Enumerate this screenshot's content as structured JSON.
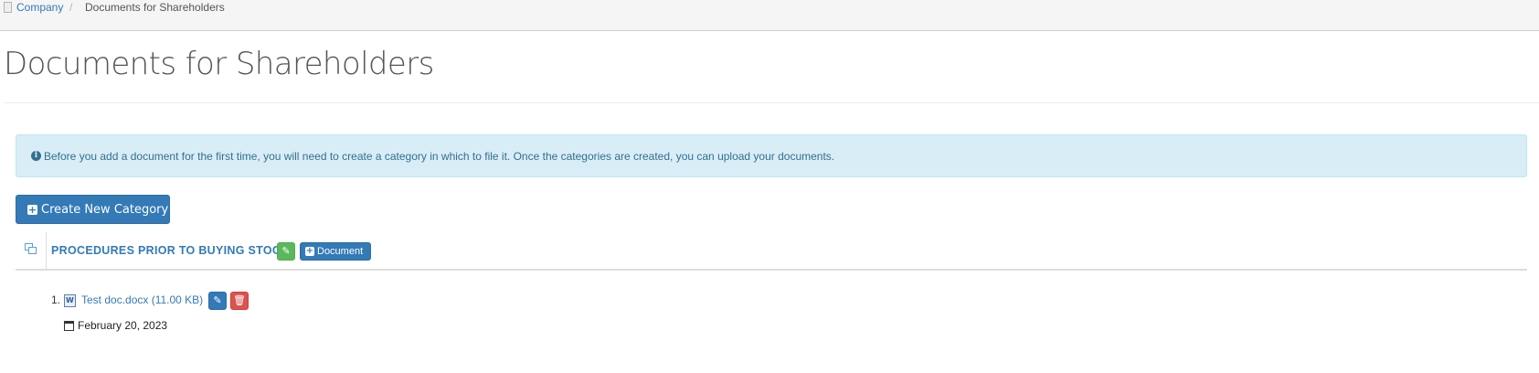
{
  "breadcrumb": {
    "icon": "page-icon",
    "items": [
      {
        "label": "Company"
      },
      {
        "label": "Documents for Shareholders"
      }
    ],
    "separator": "/"
  },
  "page": {
    "title": "Documents for Shareholders"
  },
  "alert": {
    "icon": "info-circle-icon",
    "text": "Before you add a document for the first time, you will need to create a category in which to file it. Once the categories are created, you can upload your documents."
  },
  "actions": {
    "create_category_label": "Create New Category"
  },
  "categories": [
    {
      "name": "PROCEDURES PRIOR TO BUYING STOCK",
      "add_document_label": "Document",
      "documents": [
        {
          "number": "1.",
          "file_label": "Test doc.docx (11.00 KB)",
          "file_icon": "word-file-icon",
          "date": "February 20, 2023"
        }
      ]
    }
  ],
  "colors": {
    "primary": "#337ab7",
    "success": "#5cb85c",
    "danger": "#d9534f",
    "info_bg": "#d9edf7",
    "info_text": "#31708f"
  }
}
